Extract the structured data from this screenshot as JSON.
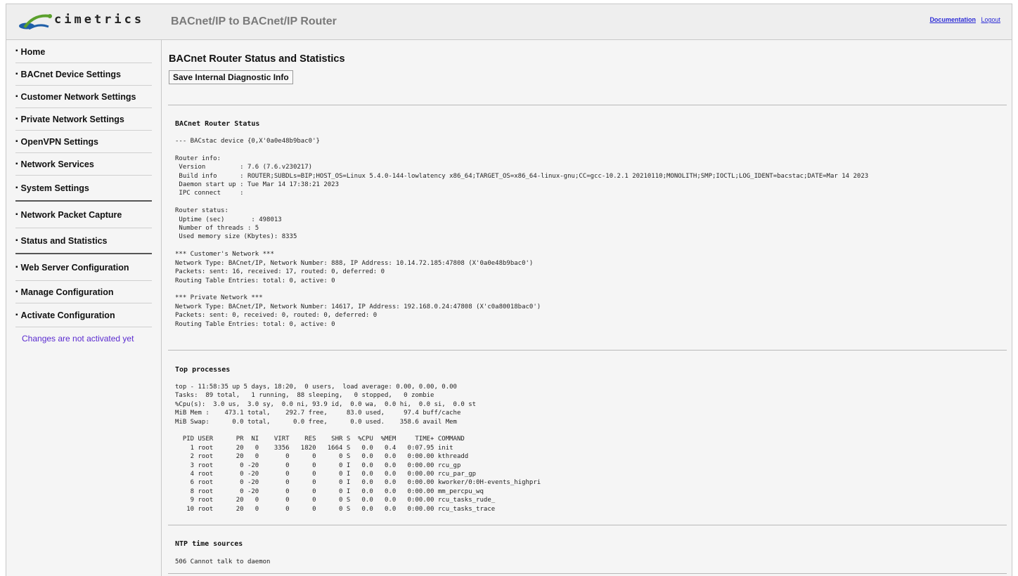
{
  "header": {
    "logo_text": "cimetrics",
    "title": "BACnet/IP to BACnet/IP Router",
    "links": [
      "Documentation",
      "Logout"
    ]
  },
  "sidebar": {
    "items": [
      {
        "label": "Home"
      },
      {
        "label": "BACnet Device Settings"
      },
      {
        "label": "Customer Network Settings"
      },
      {
        "label": "Private Network Settings"
      },
      {
        "label": "OpenVPN Settings"
      },
      {
        "label": "Network Services"
      },
      {
        "label": "System Settings"
      },
      {
        "label": "Network Packet Capture"
      },
      {
        "label": "Status and Statistics"
      },
      {
        "label": "Web Server Configuration"
      },
      {
        "label": "Manage Configuration"
      },
      {
        "label": "Activate Configuration"
      }
    ],
    "note": "Changes are not activated yet"
  },
  "main": {
    "title": "BACnet Router Status and Statistics",
    "save_button": "Save Internal Diagnostic Info",
    "sections": [
      {
        "title": "BACnet Router Status",
        "body": "--- BACstac device {0,X'0a0e48b9bac0'}\n\nRouter info:\n Version         : 7.6 (7.6.v230217)\n Build info      : ROUTER;SUBDLs=BIP;HOST_OS=Linux 5.4.0-144-lowlatency x86_64;TARGET_OS=x86_64-linux-gnu;CC=gcc-10.2.1 20210110;MONOLITH;SMP;IOCTL;LOG_IDENT=bacstac;DATE=Mar 14 2023\n Daemon start up : Tue Mar 14 17:38:21 2023\n IPC connect     :\n\nRouter status:\n Uptime (sec)       : 498013\n Number of threads : 5\n Used memory size (Kbytes): 8335\n\n*** Customer's Network ***\nNetwork Type: BACnet/IP, Network Number: 888, IP Address: 10.14.72.185:47808 (X'0a0e48b9bac0')\nPackets: sent: 16, received: 17, routed: 0, deferred: 0\nRouting Table Entries: total: 0, active: 0\n\n*** Private Network ***\nNetwork Type: BACnet/IP, Network Number: 14617, IP Address: 192.168.0.24:47808 (X'c0a80018bac0')\nPackets: sent: 0, received: 0, routed: 0, deferred: 0\nRouting Table Entries: total: 0, active: 0"
      },
      {
        "title": "Top processes",
        "body": "top - 11:58:35 up 5 days, 18:20,  0 users,  load average: 0.00, 0.00, 0.00\nTasks:  89 total,   1 running,  88 sleeping,   0 stopped,   0 zombie\n%Cpu(s):  3.0 us,  3.0 sy,  0.0 ni, 93.9 id,  0.0 wa,  0.0 hi,  0.0 si,  0.0 st\nMiB Mem :    473.1 total,    292.7 free,     83.0 used,     97.4 buff/cache\nMiB Swap:      0.0 total,      0.0 free,      0.0 used.    358.6 avail Mem\n\n  PID USER      PR  NI    VIRT    RES    SHR S  %CPU  %MEM     TIME+ COMMAND\n    1 root      20   0    3356   1820   1664 S   0.0   0.4   0:07.95 init\n    2 root      20   0       0      0      0 S   0.0   0.0   0:00.00 kthreadd\n    3 root       0 -20       0      0      0 I   0.0   0.0   0:00.00 rcu_gp\n    4 root       0 -20       0      0      0 I   0.0   0.0   0:00.00 rcu_par_gp\n    6 root       0 -20       0      0      0 I   0.0   0.0   0:00.00 kworker/0:0H-events_highpri\n    8 root       0 -20       0      0      0 I   0.0   0.0   0:00.00 mm_percpu_wq\n    9 root      20   0       0      0      0 S   0.0   0.0   0:00.00 rcu_tasks_rude_\n   10 root      20   0       0      0      0 S   0.0   0.0   0:00.00 rcu_tasks_trace"
      },
      {
        "title": "NTP time sources",
        "body": "506 Cannot talk to daemon"
      }
    ]
  },
  "colors": {
    "link": "#2b2bd6",
    "note": "#5a2bd0",
    "logo_blue": "#1f5fa8",
    "logo_green": "#5aa02c"
  }
}
